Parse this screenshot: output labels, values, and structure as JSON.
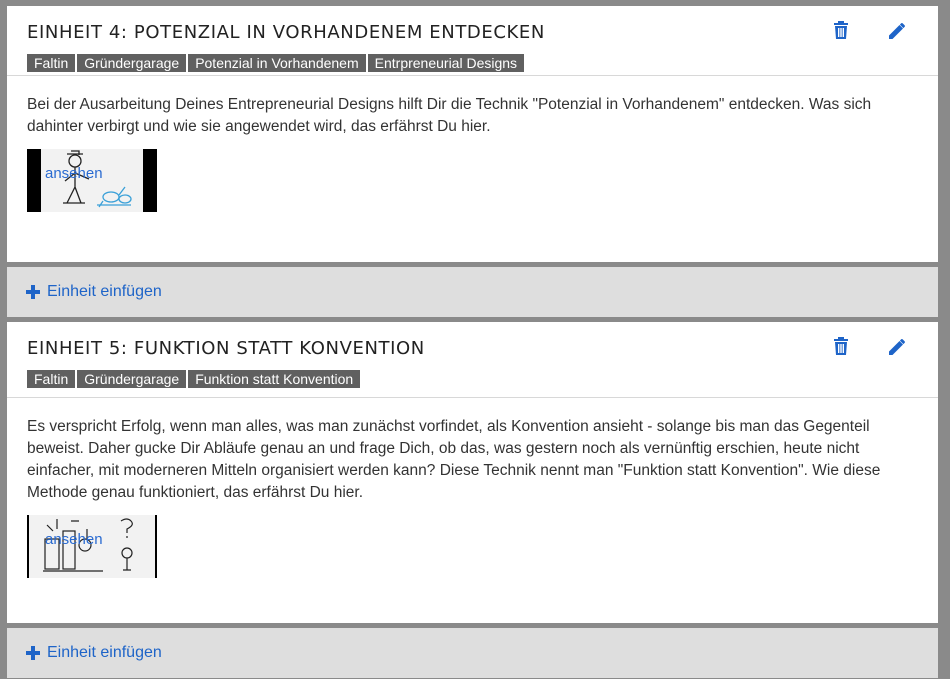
{
  "units": [
    {
      "title": "EINHEIT 4: POTENZIAL IN VORHANDENEM ENTDECKEN",
      "tags": [
        "Faltin",
        "Gründergarage",
        "Potenzial in Vorhandenem",
        "Entrpreneurial Designs"
      ],
      "description": "Bei der Ausarbeitung Deines Entrepreneurial Designs hilft Dir die Technik \"Potenzial in Vorhandenem\" entdecken. Was sich dahinter verbirgt und wie sie angewendet wird, das erfährst Du hier.",
      "video_link": "ansehen",
      "delete_icon": "trash-icon",
      "edit_icon": "pencil-icon"
    },
    {
      "title": "EINHEIT 5: FUNKTION STATT KONVENTION",
      "tags": [
        "Faltin",
        "Gründergarage",
        "Funktion statt Konvention"
      ],
      "description": "Es verspricht Erfolg, wenn man alles, was man zunächst vorfindet, als Konvention ansieht - solange bis man das Gegenteil beweist. Daher gucke Dir Abläufe genau an und frage Dich, ob das, was gestern noch als vernünftig erschien, heute nicht einfacher, mit moderneren Mitteln organisiert werden kann? Diese Technik nennt man \"Funktion statt Konvention\". Wie diese Methode genau funktioniert, das erfährst Du hier.",
      "video_link": "ansehen",
      "delete_icon": "trash-icon",
      "edit_icon": "pencil-icon"
    }
  ],
  "insert": {
    "label": "Einheit einfügen",
    "icon": "plus-icon"
  },
  "colors": {
    "accent": "#1e64c8",
    "tag_bg": "#606060",
    "insert_bg": "#dedede",
    "page_bg": "#8a8a8a"
  }
}
